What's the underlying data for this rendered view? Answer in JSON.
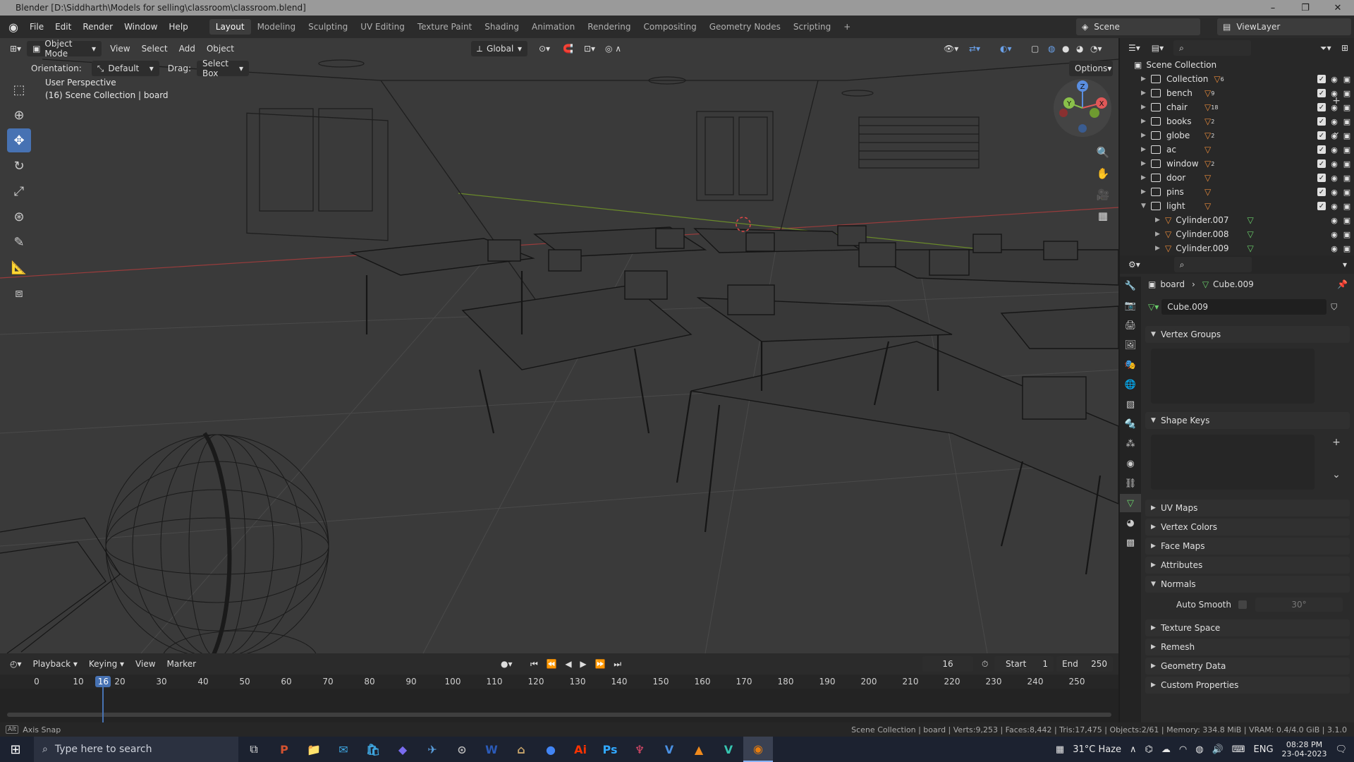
{
  "window": {
    "title": "Blender [D:\\Siddharth\\Models for selling\\classroom\\classroom.blend]",
    "controls": [
      "–",
      "❐",
      "✕"
    ]
  },
  "menu": [
    "File",
    "Edit",
    "Render",
    "Window",
    "Help"
  ],
  "workspaces": [
    "Layout",
    "Modeling",
    "Sculpting",
    "UV Editing",
    "Texture Paint",
    "Shading",
    "Animation",
    "Rendering",
    "Compositing",
    "Geometry Nodes",
    "Scripting"
  ],
  "add_workspace": "+",
  "scene": "Scene",
  "viewlayer": "ViewLayer",
  "viewport": {
    "mode": "Object Mode",
    "menus": [
      "View",
      "Select",
      "Add",
      "Object"
    ],
    "transform_orientation": "Global",
    "orientation_label": "Orientation:",
    "orientation_value": "Default",
    "drag_label": "Drag:",
    "drag_value": "Select Box",
    "options": "Options",
    "info_line1": "User Perspective",
    "info_line2": "(16) Scene Collection | board",
    "gizmo_axes": {
      "x": "X",
      "y": "Y",
      "z": "Z"
    }
  },
  "outliner": {
    "root": "Scene Collection",
    "items": [
      {
        "name": "Collection",
        "count": "6"
      },
      {
        "name": "bench",
        "count": "9"
      },
      {
        "name": "chair",
        "count": "18"
      },
      {
        "name": "books",
        "count": "2"
      },
      {
        "name": "globe",
        "count": "2"
      },
      {
        "name": "ac",
        "count": ""
      },
      {
        "name": "window",
        "count": "2"
      },
      {
        "name": "door",
        "count": ""
      },
      {
        "name": "pins",
        "count": ""
      },
      {
        "name": "light",
        "count": ""
      }
    ],
    "children": [
      "Cylinder.007",
      "Cylinder.008",
      "Cylinder.009"
    ]
  },
  "properties": {
    "breadcrumb_object": "board",
    "breadcrumb_mesh": "Cube.009",
    "mesh_name": "Cube.009",
    "panels": {
      "vertex_groups": "Vertex Groups",
      "shape_keys": "Shape Keys",
      "uv_maps": "UV Maps",
      "vertex_colors": "Vertex Colors",
      "face_maps": "Face Maps",
      "attributes": "Attributes",
      "normals": "Normals",
      "auto_smooth": "Auto Smooth",
      "auto_smooth_angle": "30°",
      "texture_space": "Texture Space",
      "remesh": "Remesh",
      "geometry_data": "Geometry Data",
      "custom_properties": "Custom Properties"
    }
  },
  "timeline": {
    "menus": [
      "Playback",
      "Keying",
      "View",
      "Marker"
    ],
    "current_frame": "16",
    "start_label": "Start",
    "start": "1",
    "end_label": "End",
    "end": "250",
    "ticks": [
      "0",
      "10",
      "20",
      "30",
      "40",
      "50",
      "60",
      "70",
      "80",
      "90",
      "100",
      "110",
      "120",
      "130",
      "140",
      "150",
      "160",
      "170",
      "180",
      "190",
      "200",
      "210",
      "220",
      "230",
      "240",
      "250"
    ]
  },
  "statusbar": {
    "left": "Axis Snap",
    "right": "Scene Collection | board | Verts:9,253 | Faces:8,442 | Tris:17,475 | Objects:2/61 | Memory: 334.8 MiB | VRAM: 0.4/4.0 GiB | 3.1.0"
  },
  "taskbar": {
    "search_placeholder": "Type here to search",
    "weather": "31°C Haze",
    "language": "ENG",
    "time": "08:28 PM",
    "date": "23-04-2023",
    "apps": [
      "P",
      "📁",
      "✉",
      "🛍",
      "◆",
      "✈",
      "⊙",
      "W",
      "⌂",
      "●",
      "Ai",
      "Ps",
      "♆",
      "V",
      "▲",
      "V",
      "◉"
    ]
  }
}
